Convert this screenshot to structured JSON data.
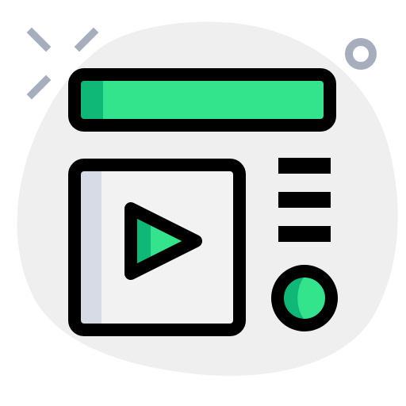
{
  "icon": {
    "name": "video-player-app-icon",
    "colors": {
      "background_blob": "#efefef",
      "accent": "#34e48d",
      "accent_dark": "#10b877",
      "panel": "#f2f2f2",
      "panel_shadow": "#d6dbe6",
      "outline": "#000000",
      "decoration": "#a6adbd"
    },
    "parts": [
      "header-bar",
      "video-frame",
      "play-icon",
      "menu-lines-icon",
      "record-dot-icon"
    ]
  }
}
